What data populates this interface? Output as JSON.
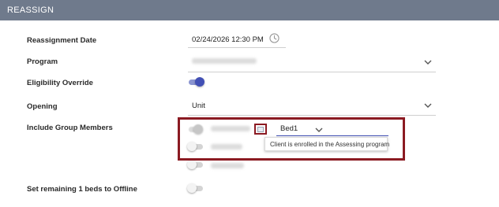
{
  "header": {
    "title": "REASSIGN"
  },
  "form": {
    "reassignment_date": {
      "label": "Reassignment Date",
      "value": "02/24/2026 12:30 PM"
    },
    "program": {
      "label": "Program"
    },
    "eligibility_override": {
      "label": "Eligibility Override",
      "enabled": true
    },
    "opening": {
      "label": "Opening",
      "value": "Unit"
    },
    "include_group_members": {
      "label": "Include Group Members",
      "bed_select_value": "Bed1",
      "tooltip": "Client is enrolled in the Assessing program"
    },
    "set_offline": {
      "label": "Set remaining 1 beds to Offline",
      "enabled": false
    }
  },
  "colors": {
    "header_bg": "#6f7a8c",
    "accent": "#4250b5",
    "highlight": "#8b1a22"
  }
}
